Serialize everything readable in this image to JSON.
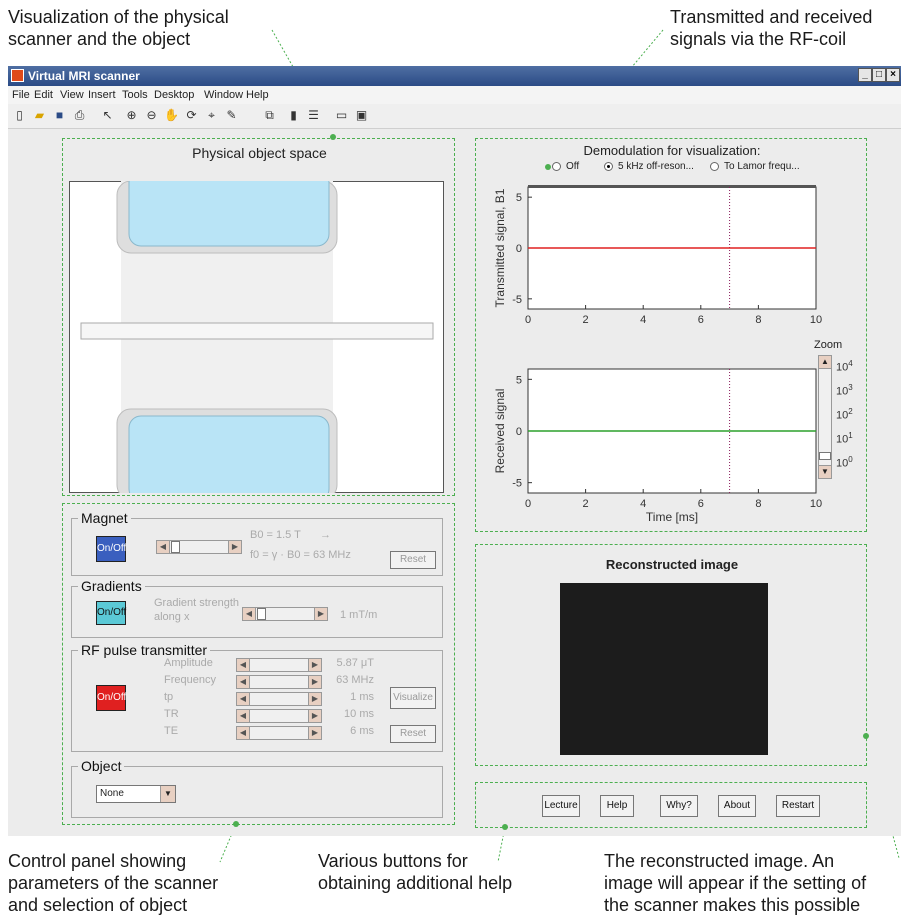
{
  "annotations": {
    "top_left": "Visualization of the physical\nscanner and the object",
    "top_right": "Transmitted and received\nsignals via the RF-coil",
    "bottom_left": "Control panel showing\nparameters of the scanner\nand selection of object",
    "bottom_middle": "Various buttons for\nobtaining additional help",
    "bottom_right": "The reconstructed image. An\nimage will appear if the setting of\nthe scanner makes this possible"
  },
  "window": {
    "title": "Virtual MRI scanner",
    "menu": [
      "File",
      "Edit",
      "View",
      "Insert",
      "Tools",
      "Desktop",
      "Window",
      "Help"
    ]
  },
  "physical": {
    "title": "Physical object space"
  },
  "magnet": {
    "title": "Magnet",
    "onoff": "On/Off",
    "b0": "B0 = 1.5 T",
    "arrow": "→",
    "f0": "f0 = γ · B0 = 63 MHz",
    "reset": "Reset",
    "color": "#3a5fbf"
  },
  "gradients": {
    "title": "Gradients",
    "onoff": "On/Off",
    "label1": "Gradient strength",
    "label2": "along x",
    "value": "1 mT/m",
    "color": "#5bc9d6"
  },
  "rf": {
    "title": "RF pulse transmitter",
    "onoff": "On/Off",
    "color": "#e02020",
    "params": [
      {
        "label": "Amplitude",
        "value": "5.87 μT"
      },
      {
        "label": "Frequency",
        "value": "63 MHz"
      },
      {
        "label": "tp",
        "value": "1 ms"
      },
      {
        "label": "TR",
        "value": "10 ms"
      },
      {
        "label": "TE",
        "value": "6 ms"
      }
    ],
    "visualize": "Visualize",
    "reset": "Reset"
  },
  "object": {
    "title": "Object",
    "selected": "None"
  },
  "demod": {
    "title": "Demodulation for visualization:",
    "options": [
      "Off",
      "5 kHz off-reson...",
      "To Lamor frequ..."
    ],
    "selected_index": 1
  },
  "chart_data": [
    {
      "type": "line",
      "ylabel": "Transmitted signal, B1",
      "xlabel": "",
      "xlim": [
        0,
        10
      ],
      "ylim": [
        -6,
        6
      ],
      "xticks": [
        "0",
        "2",
        "4",
        "6",
        "8",
        "10"
      ],
      "yticks": [
        "5",
        "0",
        "-5"
      ],
      "series": [
        {
          "x": [
            0,
            10
          ],
          "y": [
            0,
            0
          ],
          "color": "#e02020"
        }
      ],
      "marker_x": 7
    },
    {
      "type": "line",
      "ylabel": "Received signal",
      "xlabel": "Time [ms]",
      "xlim": [
        0,
        10
      ],
      "ylim": [
        -6,
        6
      ],
      "xticks": [
        "0",
        "2",
        "4",
        "6",
        "8",
        "10"
      ],
      "yticks": [
        "5",
        "0",
        "-5"
      ],
      "series": [
        {
          "x": [
            0,
            10
          ],
          "y": [
            0,
            0
          ],
          "color": "#2ca02c"
        }
      ],
      "marker_x": 7
    }
  ],
  "zoom": {
    "label": "Zoom",
    "levels": [
      "10^4",
      "10^3",
      "10^2",
      "10^1",
      "10^0"
    ]
  },
  "recon": {
    "title": "Reconstructed image"
  },
  "help_buttons": [
    "Lecture",
    "Help",
    "Why?",
    "About",
    "Restart"
  ]
}
